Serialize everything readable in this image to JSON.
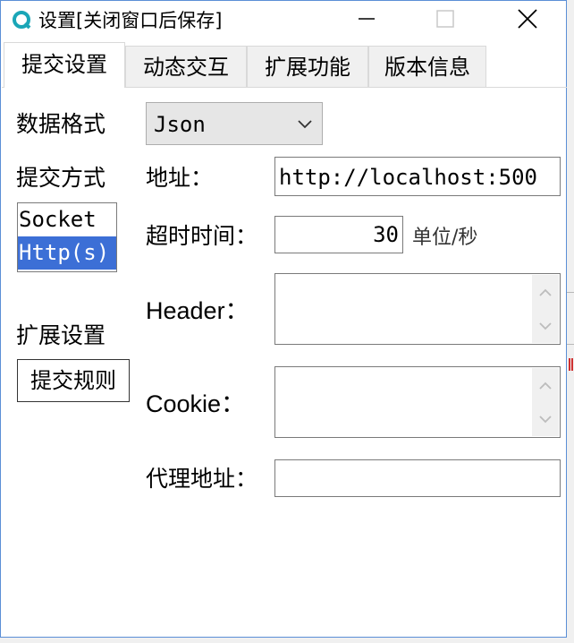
{
  "window": {
    "title": "设置[关闭窗口后保存]",
    "accent_color": "#5b8fd6"
  },
  "tabs": [
    {
      "label": "提交设置",
      "active": true
    },
    {
      "label": "动态交互",
      "active": false
    },
    {
      "label": "扩展功能",
      "active": false
    },
    {
      "label": "版本信息",
      "active": false
    }
  ],
  "left": {
    "data_format_label": "数据格式",
    "submit_method_label": "提交方式",
    "methods": [
      {
        "label": "Socket",
        "selected": false
      },
      {
        "label": "Http(s)",
        "selected": true
      }
    ],
    "ext_settings_label": "扩展设置",
    "submit_rules_button": "提交规则"
  },
  "form": {
    "format_value": "Json",
    "address_label": "地址：",
    "address_value": "http://localhost:500",
    "timeout_label": "超时时间：",
    "timeout_value": "30",
    "timeout_unit": "单位/秒",
    "header_label": "Header：",
    "cookie_label": "Cookie：",
    "proxy_label": "代理地址：",
    "proxy_value": ""
  },
  "icons": {
    "app": "app-logo-icon",
    "minimize": "minimize-icon",
    "maximize": "maximize-icon",
    "close": "close-icon",
    "dropdown": "chevron-down-icon"
  },
  "colors": {
    "selection": "#3c6fd6",
    "app_icon": "#1aa6b7"
  }
}
